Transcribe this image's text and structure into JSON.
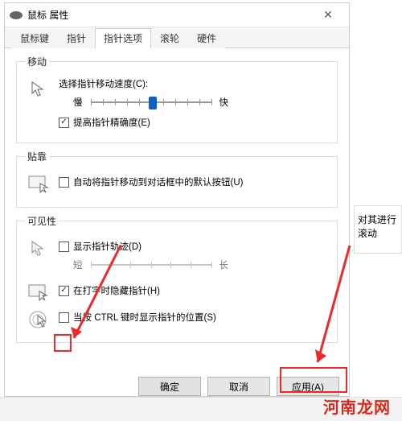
{
  "window": {
    "title": "鼠标 属性"
  },
  "tabs": [
    {
      "label": "鼠标键"
    },
    {
      "label": "指针"
    },
    {
      "label": "指针选项"
    },
    {
      "label": "滚轮"
    },
    {
      "label": "硬件"
    }
  ],
  "groups": {
    "motion": {
      "legend": "移动",
      "speed_label": "选择指针移动速度(C):",
      "slow": "慢",
      "fast": "快",
      "precision_label": "提高指针精确度(E)",
      "precision_checked": true
    },
    "snap": {
      "legend": "贴靠",
      "snap_label": "自动将指针移动到对话框中的默认按钮(U)",
      "snap_checked": false
    },
    "visibility": {
      "legend": "可见性",
      "trail_label": "显示指针轨迹(D)",
      "trail_checked": false,
      "trail_short": "短",
      "trail_long": "长",
      "hide_label": "在打字时隐藏指针(H)",
      "hide_checked": true,
      "ctrl_label": "当按 CTRL 键时显示指针的位置(S)",
      "ctrl_checked": false
    }
  },
  "buttons": {
    "ok": "确定",
    "cancel": "取消",
    "apply": "应用(A)"
  },
  "behind_text": "对其进行滚动",
  "watermark": "河南龙网"
}
